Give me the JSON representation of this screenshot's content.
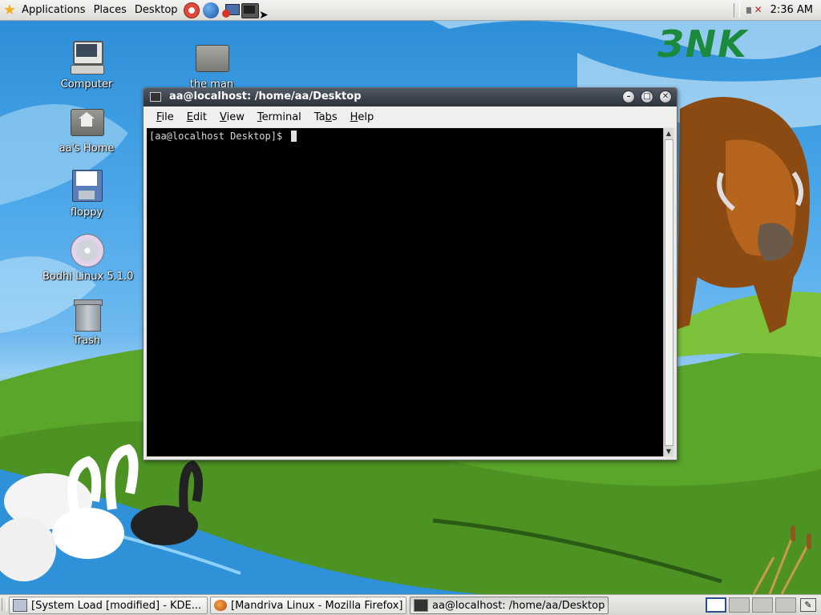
{
  "top_panel": {
    "menus": [
      "Applications",
      "Places",
      "Desktop"
    ],
    "launchers": [
      "help-icon",
      "web-browser-icon",
      "email-icon",
      "terminal-launcher-icon"
    ],
    "clock": "2:36 AM"
  },
  "desktop": {
    "logo_text": "ЗNK",
    "icons": [
      {
        "label": "Computer",
        "icon": "computer-icon"
      },
      {
        "label": "aa's Home",
        "icon": "home-folder-icon"
      },
      {
        "label": "floppy",
        "icon": "floppy-icon"
      },
      {
        "label": "Bodhi Linux 5.1.0",
        "icon": "cdrom-icon"
      },
      {
        "label": "Trash",
        "icon": "trash-icon"
      },
      {
        "label": "the man",
        "icon": "folder-icon"
      }
    ]
  },
  "terminal": {
    "title": "aa@localhost: /home/aa/Desktop",
    "menu": [
      "File",
      "Edit",
      "View",
      "Terminal",
      "Tabs",
      "Help"
    ],
    "mnemonics": [
      "F",
      "E",
      "V",
      "T",
      "b",
      "H"
    ],
    "prompt": "[aa@localhost Desktop]$ "
  },
  "taskbar": {
    "tasks": [
      {
        "label": "[System Load [modified] - KDE...",
        "icon": "kde-app-icon",
        "active": false
      },
      {
        "label": "[Mandriva Linux - Mozilla Firefox]",
        "icon": "firefox-icon",
        "active": false
      },
      {
        "label": "aa@localhost: /home/aa/Desktop",
        "icon": "terminal-icon",
        "active": true
      }
    ],
    "workspaces": 4,
    "current_workspace": 1
  },
  "colors": {
    "terminal_bg": "#000000",
    "titlebar": "#3a414b",
    "sky": "#4aa6e8",
    "grass": "#5fae2c"
  }
}
